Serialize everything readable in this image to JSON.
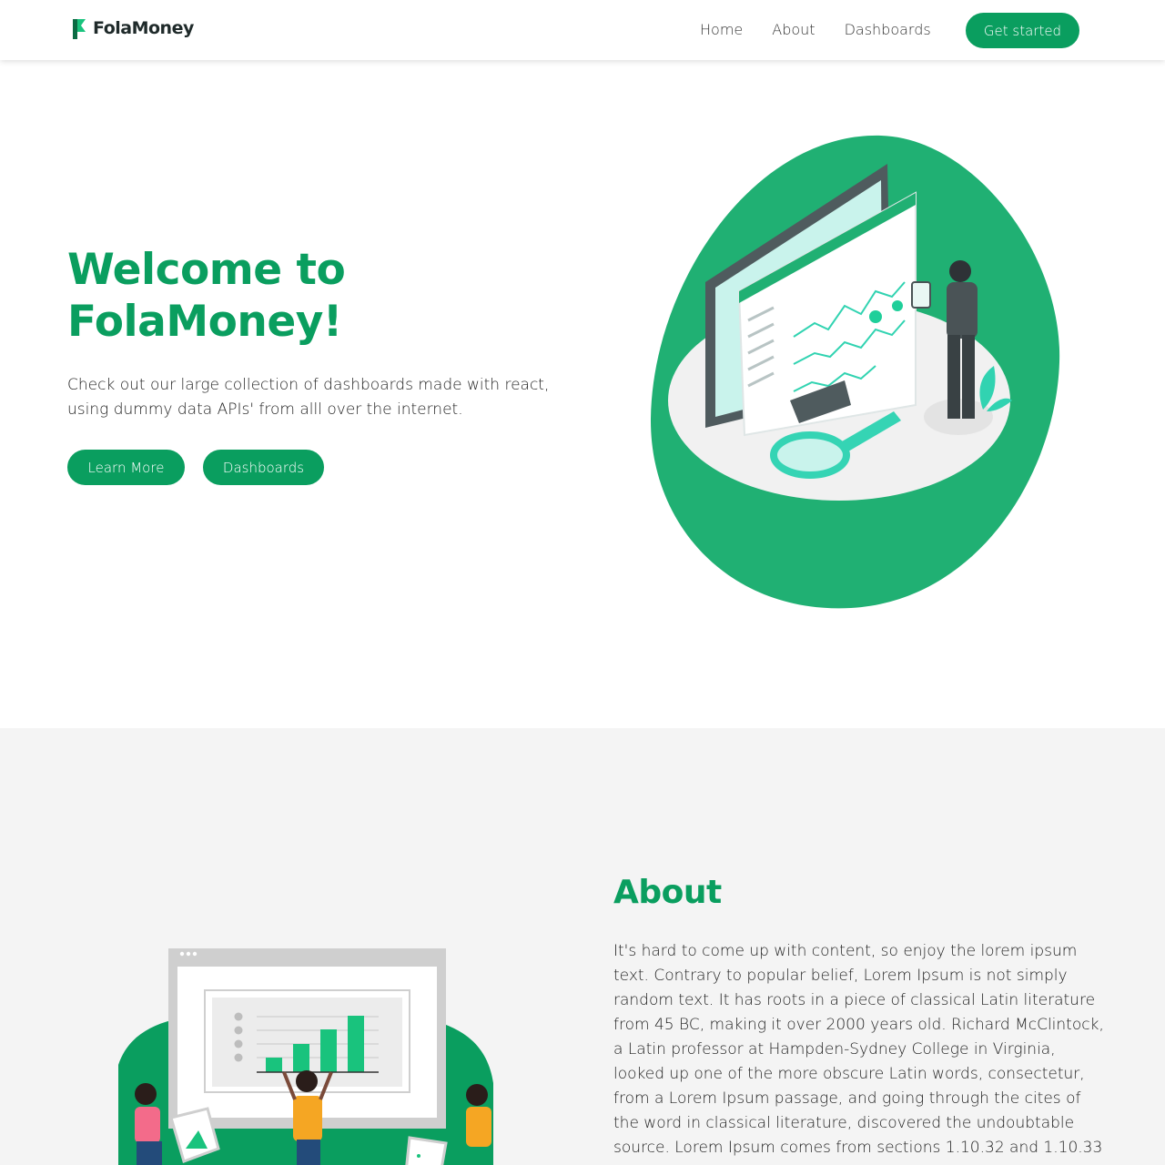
{
  "brand": {
    "name": "FolaMoney",
    "accent": "#0a9e5f"
  },
  "nav": {
    "links": [
      "Home",
      "About",
      "Dashboards"
    ],
    "cta_label": "Get started"
  },
  "hero": {
    "title_line1": "Welcome to",
    "title_line2": "FolaMoney!",
    "text": "Check out our large collection of dashboards made with react, using dummy data APIs' from alll over the internet.",
    "learn_more_label": "Learn More",
    "dashboards_label": "Dashboards",
    "illustration_icon": "dashboard-analytics-illustration"
  },
  "about": {
    "title": "About",
    "text": "It's hard to come up with content, so enjoy the lorem ipsum text. Contrary to popular belief, Lorem Ipsum is not simply random text. It has roots in a piece of classical Latin literature from 45 BC, making it over 2000 years old. Richard McClintock, a Latin professor at Hampden-Sydney College in Virginia, looked up one of the more obscure Latin words, consectetur, from a Lorem Ipsum passage, and going through the cites of the word in classical literature, discovered the undoubtable source. Lorem Ipsum comes from sections 1.10.32 and 1.10.33",
    "illustration_icon": "team-chart-illustration"
  }
}
